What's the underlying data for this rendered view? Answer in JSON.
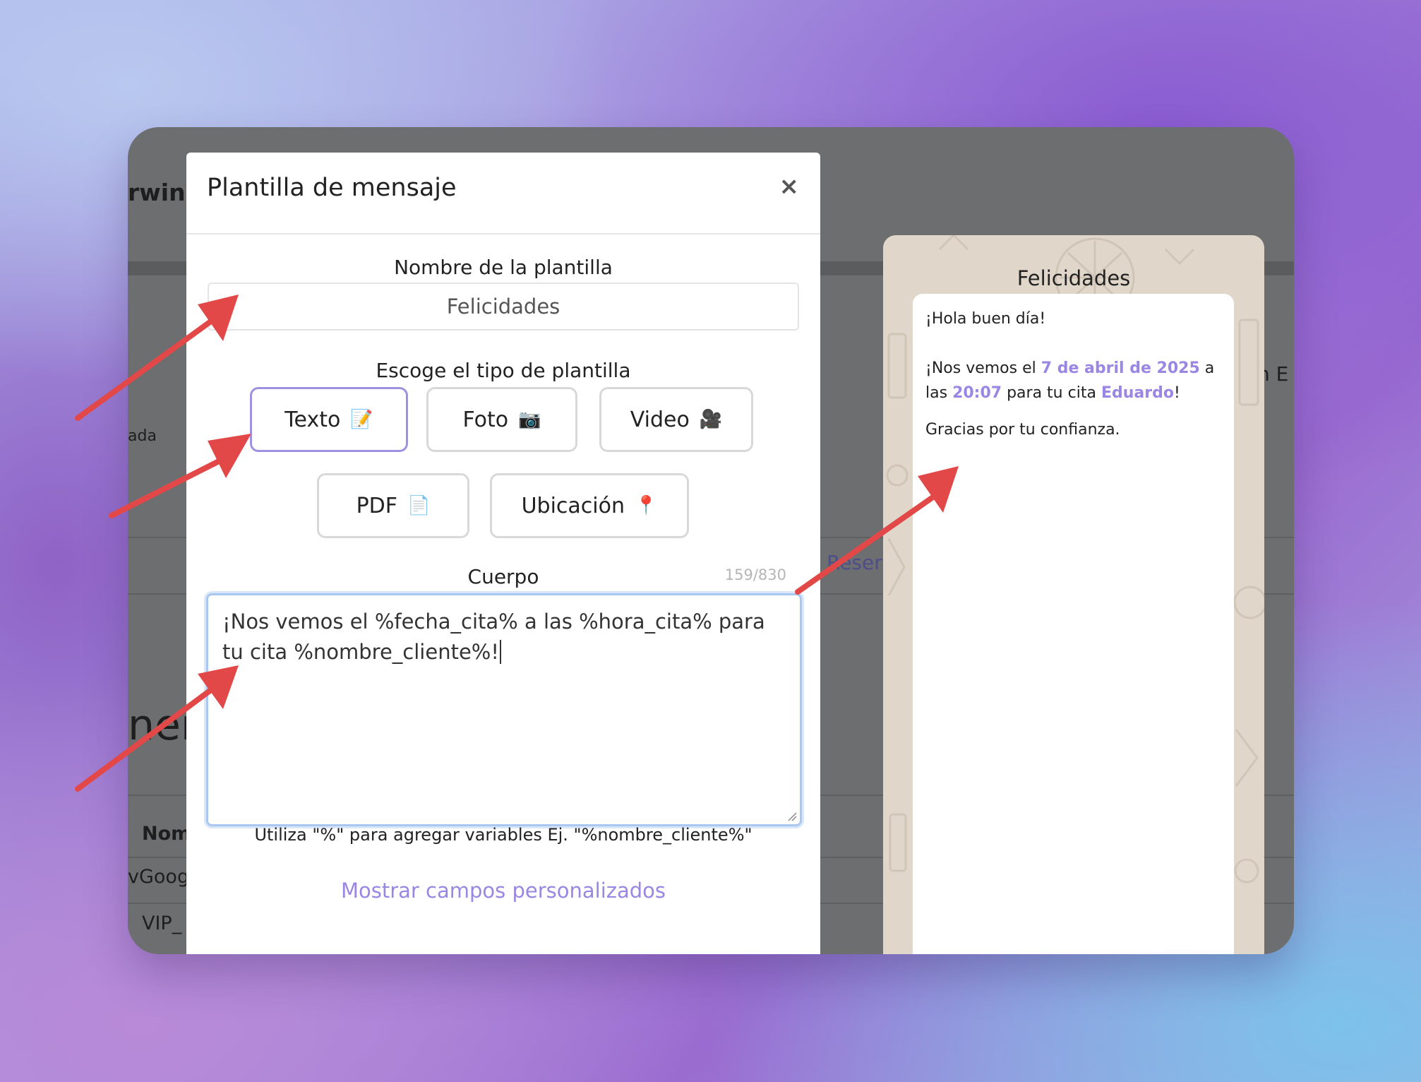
{
  "background_app": {
    "brand_fragment": "rwinn",
    "side_text": "ada",
    "heading_fragment": "nen",
    "table_header_fragment": "Nom",
    "row_1": "vGoog",
    "row_2": "VIP_",
    "link_fragment": "Reser",
    "right_fragment": "n E"
  },
  "modal": {
    "title": "Plantilla de mensaje",
    "close_symbol": "×",
    "name_label": "Nombre de la plantilla",
    "name_value": "Felicidades",
    "type_label": "Escoge el tipo de plantilla",
    "types": [
      {
        "label": "Texto",
        "icon": "📝",
        "active": true
      },
      {
        "label": "Foto",
        "icon": "📷",
        "active": false
      },
      {
        "label": "Video",
        "icon": "🎥",
        "active": false
      },
      {
        "label": "PDF",
        "icon": "📄",
        "active": false
      },
      {
        "label": "Ubicación",
        "icon": "📍",
        "active": false
      }
    ],
    "body_label": "Cuerpo",
    "char_counter": "159/830",
    "body_text": "¡Nos vemos el %fecha_cita% a las %hora_cita% para tu cita %nombre_cliente%!",
    "hint": "Utiliza \"%\" para agregar variables Ej. \"%nombre_cliente%\"",
    "custom_fields_link": "Mostrar campos personalizados"
  },
  "preview": {
    "title": "Felicidades",
    "greeting": "¡Hola buen día!",
    "line_a": "¡Nos vemos el ",
    "date": "7 de abril de 2025",
    "line_b": " a las ",
    "time": "20:07",
    "line_c": " para tu cita ",
    "client": "Eduardo",
    "line_d": "!",
    "closing": "Gracias por tu confianza."
  },
  "colors": {
    "accent": "#9a86e3",
    "active_border": "#9f91e2",
    "arrow": "#e34848",
    "overlay": "#6d6e70",
    "preview_bg": "#e0d6ca"
  }
}
